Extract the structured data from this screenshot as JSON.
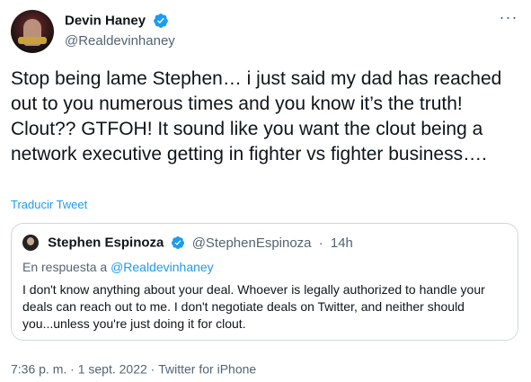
{
  "author": {
    "name": "Devin Haney",
    "handle": "@Realdevinhaney"
  },
  "tweet": {
    "text": "Stop being lame Stephen… i just said my dad has reached out to you numerous times and you know it’s the truth! Clout?? GTFOH! It sound like you want the clout being a network executive getting in fighter vs fighter business….",
    "translate_label": "Traducir Tweet"
  },
  "quoted": {
    "name": "Stephen Espinoza",
    "handle": "@StephenEspinoza",
    "separator": "·",
    "time": "14h",
    "reply_prefix": "En respuesta a",
    "reply_to": "@Realdevinhaney",
    "text": "I don't know anything about your deal. Whoever is legally authorized to handle your deals can reach out to me. I don't negotiate deals on Twitter, and neither should you...unless you're just doing it for clout."
  },
  "meta": {
    "time": "7:36 p. m.",
    "sep1": "·",
    "date": "1 sept. 2022",
    "sep2": "·",
    "source": "Twitter for iPhone"
  },
  "colors": {
    "accent": "#1d9bf0",
    "secondary_text": "#536471",
    "primary_text": "#0f1419",
    "border": "#cfd9de"
  },
  "icons": {
    "verified": "verified-badge-icon",
    "more": "more-options-icon"
  }
}
